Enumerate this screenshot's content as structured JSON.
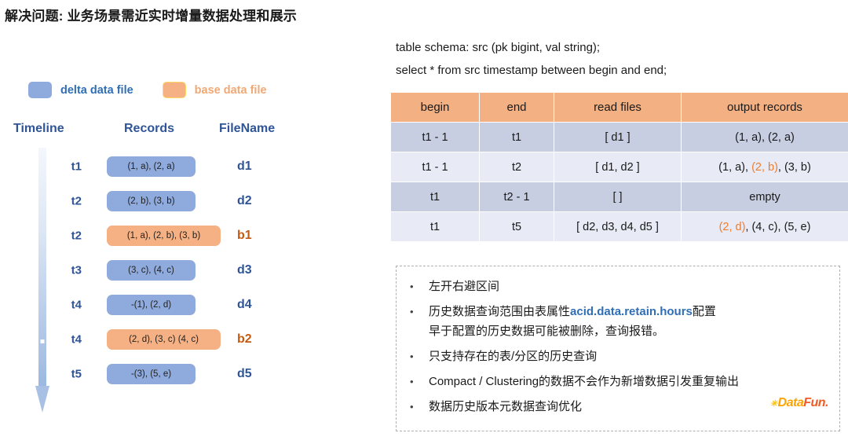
{
  "title": "解决问题: 业务场景需近实时增量数据处理和展示",
  "legend": {
    "delta_label": "delta data file",
    "base_label": "base data file",
    "delta_color": "#8faadc",
    "base_color": "#f5b183"
  },
  "timeline": {
    "headers": {
      "timeline": "Timeline",
      "records": "Records",
      "filename": "FileName"
    },
    "rows": [
      {
        "time": "t1",
        "records": "(1, a),  (2, a)",
        "file": "d1",
        "kind": "delta"
      },
      {
        "time": "t2",
        "records": "(2, b),  (3, b)",
        "file": "d2",
        "kind": "delta"
      },
      {
        "time": "t2",
        "records": "(1, a), (2, b), (3, b)",
        "file": "b1",
        "kind": "base"
      },
      {
        "time": "t3",
        "records": "(3, c),  (4, c)",
        "file": "d3",
        "kind": "delta"
      },
      {
        "time": "t4",
        "records": "-(1),  (2, d)",
        "file": "d4",
        "kind": "delta"
      },
      {
        "time": "t4",
        "records": "(2, d), (3, c) (4, c)",
        "file": "b2",
        "kind": "base"
      },
      {
        "time": "t5",
        "records": "-(3),  (5, e)",
        "file": "d5",
        "kind": "delta"
      }
    ]
  },
  "schema": {
    "line1": "table schema:  src (pk bigint, val string);",
    "line2": "select * from src timestamp between begin and end;"
  },
  "table": {
    "headers": [
      "begin",
      "end",
      "read files",
      "output records"
    ],
    "rows": [
      {
        "begin": "t1 - 1",
        "end": "t1",
        "read_files": "[ d1 ]",
        "output": [
          {
            "t": "(1, a),  (2, a)",
            "hl": false
          }
        ]
      },
      {
        "begin": "t1 - 1",
        "end": "t2",
        "read_files": "[ d1, d2 ]",
        "output": [
          {
            "t": "(1, a), ",
            "hl": false
          },
          {
            "t": "(2, b)",
            "hl": true
          },
          {
            "t": ", (3, b)",
            "hl": false
          }
        ]
      },
      {
        "begin": "t1",
        "end": "t2 - 1",
        "read_files": "[ ]",
        "output": [
          {
            "t": "empty",
            "hl": false
          }
        ]
      },
      {
        "begin": "t1",
        "end": "t5",
        "read_files": "[ d2, d3, d4, d5 ]",
        "output": [
          {
            "t": "(2, d)",
            "hl": true
          },
          {
            "t": ", (4, c), (5, e)",
            "hl": false
          }
        ]
      }
    ]
  },
  "notes": [
    [
      {
        "t": "左开右避区间",
        "hl": false
      }
    ],
    [
      {
        "t": "历史数据查询范围由表属性",
        "hl": false
      },
      {
        "t": "acid.data.retain.hours",
        "hl": true
      },
      {
        "t": "配置",
        "hl": false
      },
      {
        "t": "BR",
        "hl": false
      },
      {
        "t": "早于配置的历史数据可能被删除，查询报错。",
        "hl": false
      }
    ],
    [
      {
        "t": "只支持存在的表/分区的历史查询",
        "hl": false
      }
    ],
    [
      {
        "t": "Compact / Clustering的数据不会作为新增数据引发重复输出",
        "hl": false
      }
    ],
    [
      {
        "t": "数据历史版本元数据查询优化",
        "hl": false
      }
    ]
  ],
  "logo": {
    "spark": "✳",
    "part1": "Data",
    "part2": "Fun."
  }
}
